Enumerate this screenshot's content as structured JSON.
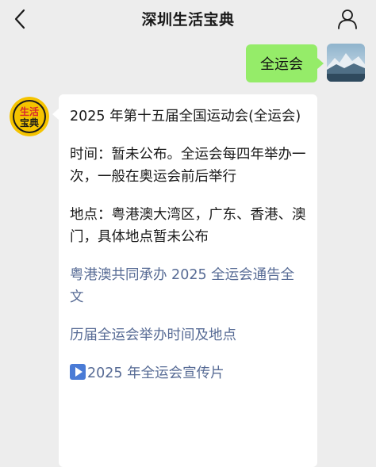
{
  "header": {
    "title": "深圳生活宝典"
  },
  "user_message": {
    "text": "全运会"
  },
  "bot": {
    "avatar_text_line1": "生活",
    "avatar_text_line2": "宝典",
    "paragraphs": [
      "2025 年第十五届全国运动会(全运会)",
      "时间：暂未公布。全运会每四年举办一次，一般在奥运会前后举行",
      "地点：粤港澳大湾区，广东、香港、澳门，具体地点暂未公布"
    ],
    "links": [
      "粤港澳共同承办 2025 全运会通告全文",
      "历届全运会举办时间及地点"
    ],
    "video_link": "2025 年全运会宣传片"
  },
  "colors": {
    "background": "#ededed",
    "user_bubble": "#95ec69",
    "bot_bubble": "#ffffff",
    "link": "#576b95",
    "avatar_bg": "#f5c400"
  },
  "icons": {
    "back": "chevron-left-icon",
    "profile": "person-icon",
    "video": "play-icon"
  }
}
